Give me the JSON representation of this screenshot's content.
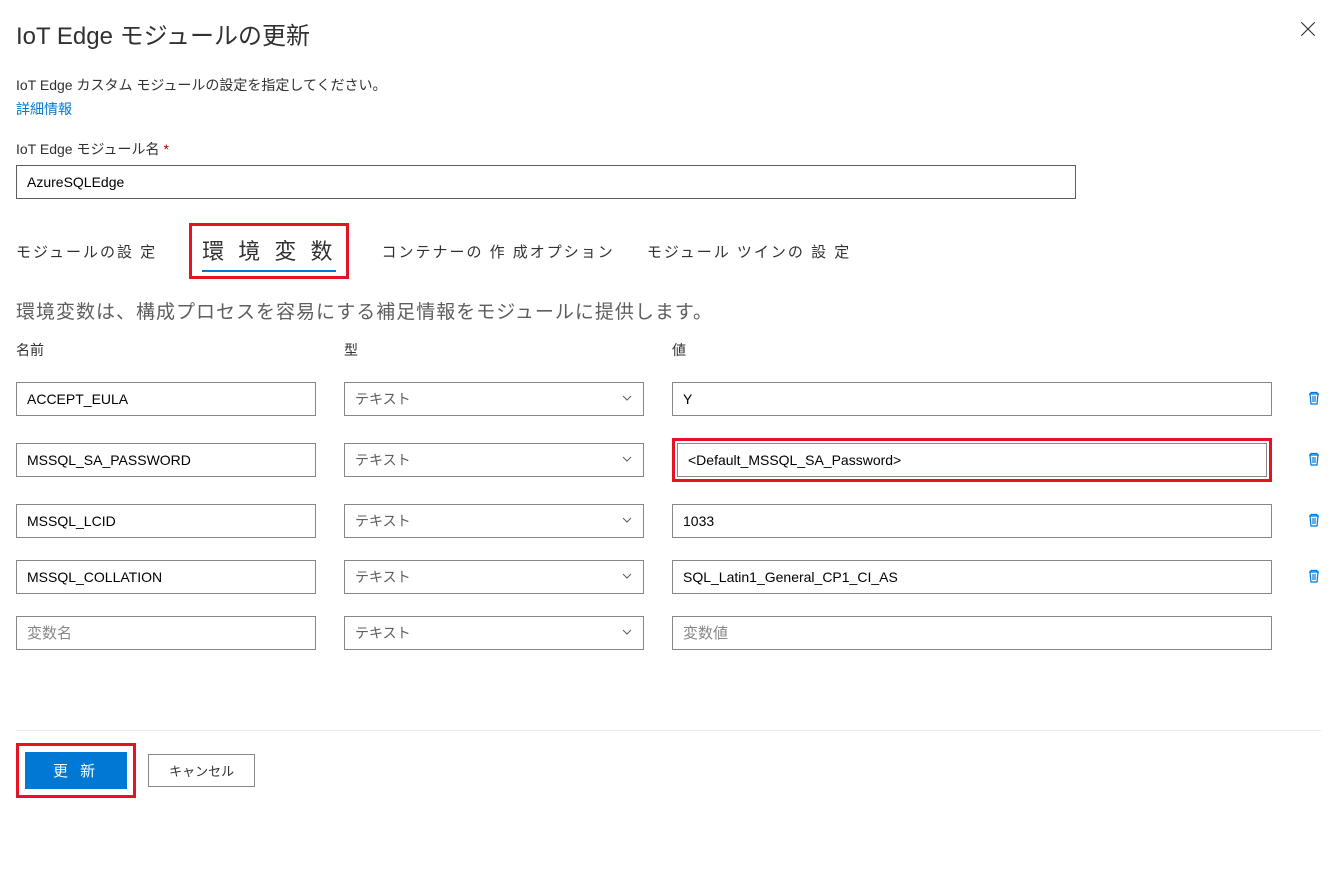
{
  "header": {
    "title": "IoT Edge モジュールの更新"
  },
  "description": {
    "text": "IoT Edge カスタム モジュールの設定を指定してください。",
    "more_info": "詳細情報"
  },
  "module_name": {
    "label": "IoT Edge モジュール名",
    "value": "AzureSQLEdge"
  },
  "tabs": {
    "module_settings": "モジュールの設 定",
    "env_vars": "環 境 変 数",
    "container_options": "コンテナーの 作 成オプション",
    "module_twin": "モジュール ツインの 設 定"
  },
  "env_description": "環境変数は、構成プロセスを容易にする補足情報をモジュールに提供します。",
  "columns": {
    "name": "名前",
    "type": "型",
    "value": "値"
  },
  "type_option": "テキスト",
  "rows": [
    {
      "name": "ACCEPT_EULA",
      "value": "Y"
    },
    {
      "name": "MSSQL_SA_PASSWORD",
      "value": "<Default_MSSQL_SA_Password>"
    },
    {
      "name": "MSSQL_LCID",
      "value": "1033"
    },
    {
      "name": "MSSQL_COLLATION",
      "value": "SQL_Latin1_General_CP1_CI_AS"
    }
  ],
  "placeholders": {
    "name": "変数名",
    "value": "変数値"
  },
  "footer": {
    "primary": "更 新",
    "secondary": "キャンセル"
  }
}
